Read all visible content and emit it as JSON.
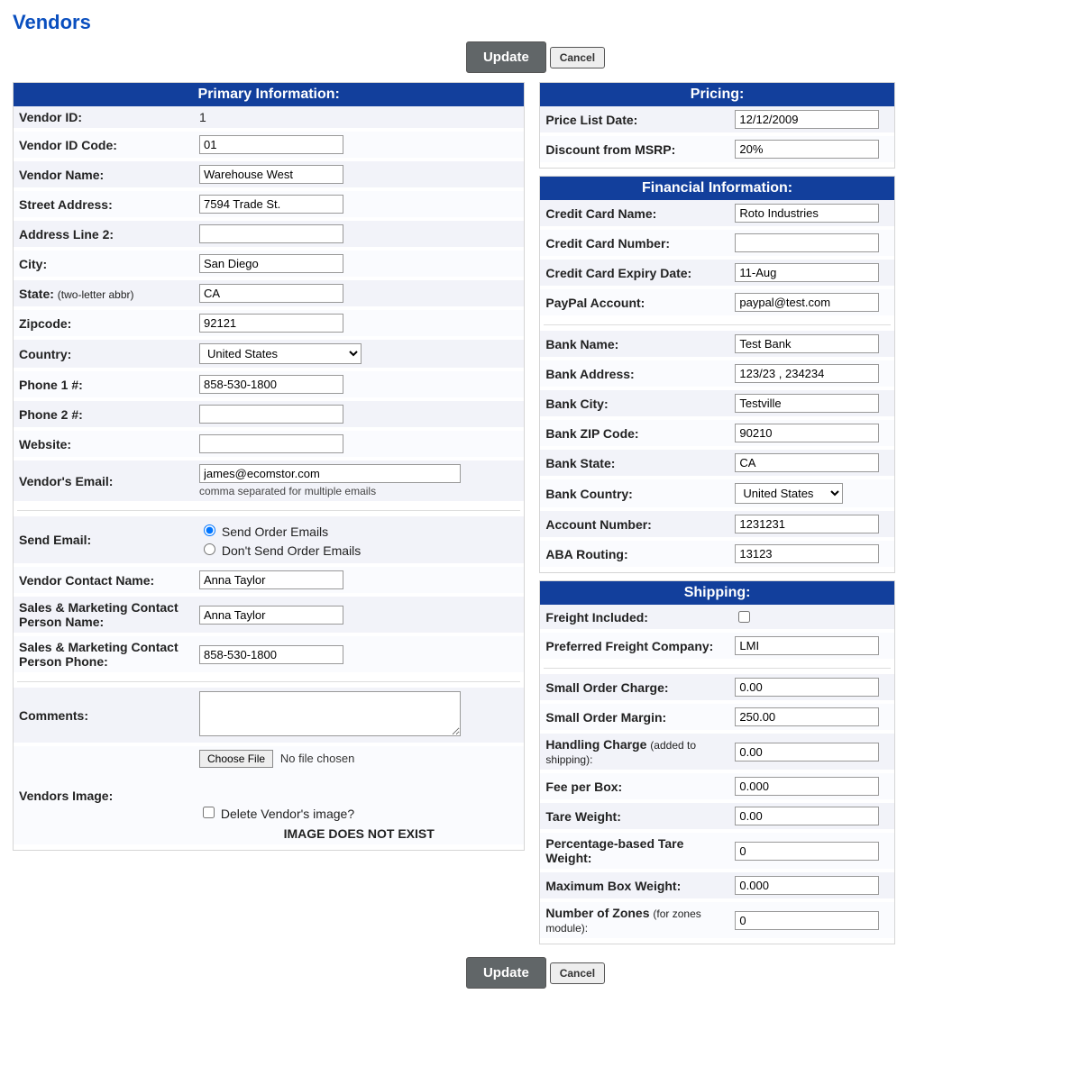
{
  "title": "Vendors",
  "buttons": {
    "update": "Update",
    "cancel": "Cancel"
  },
  "primary": {
    "header": "Primary Information:",
    "labels": {
      "vendor_id": "Vendor ID:",
      "vendor_id_code": "Vendor ID Code:",
      "vendor_name": "Vendor Name:",
      "street": "Street Address:",
      "addr2": "Address Line 2:",
      "city": "City:",
      "state": "State:",
      "state_sub": "(two-letter abbr)",
      "zip": "Zipcode:",
      "country": "Country:",
      "phone1": "Phone 1 #:",
      "phone2": "Phone 2 #:",
      "website": "Website:",
      "email": "Vendor's Email:",
      "email_hint": "comma separated for multiple emails",
      "send_email": "Send Email:",
      "send_opt1": "Send Order Emails",
      "send_opt2": "Don't Send Order Emails",
      "contact_name": "Vendor Contact Name:",
      "sm_name": "Sales & Marketing Contact Person Name:",
      "sm_phone": "Sales & Marketing Contact Person Phone:",
      "comments": "Comments:",
      "image": "Vendors Image:",
      "choose_file": "Choose File",
      "no_file": "No file chosen",
      "delete_img": "Delete Vendor's image?",
      "img_missing": "IMAGE DOES NOT EXIST"
    },
    "values": {
      "vendor_id": "1",
      "vendor_id_code": "01",
      "vendor_name": "Warehouse West",
      "street": "7594 Trade St.",
      "addr2": "",
      "city": "San Diego",
      "state": "CA",
      "zip": "92121",
      "country": "United States",
      "phone1": "858-530-1800",
      "phone2": "",
      "website": "",
      "email": "james@ecomstor.com",
      "contact_name": "Anna Taylor",
      "sm_name": "Anna Taylor",
      "sm_phone": "858-530-1800",
      "comments": ""
    }
  },
  "pricing": {
    "header": "Pricing:",
    "labels": {
      "date": "Price List Date:",
      "discount": "Discount from MSRP:"
    },
    "values": {
      "date": "12/12/2009",
      "discount": "20%"
    }
  },
  "financial": {
    "header": "Financial Information:",
    "labels": {
      "cc_name": "Credit Card Name:",
      "cc_num": "Credit Card Number:",
      "cc_exp": "Credit Card Expiry Date:",
      "paypal": "PayPal Account:",
      "bank_name": "Bank Name:",
      "bank_addr": "Bank Address:",
      "bank_city": "Bank City:",
      "bank_zip": "Bank ZIP Code:",
      "bank_state": "Bank State:",
      "bank_country": "Bank Country:",
      "acct_num": "Account Number:",
      "aba": "ABA Routing:"
    },
    "values": {
      "cc_name": "Roto Industries",
      "cc_num": "",
      "cc_exp": "11-Aug",
      "paypal": "paypal@test.com",
      "bank_name": "Test Bank",
      "bank_addr": "123/23 , 234234",
      "bank_city": "Testville",
      "bank_zip": "90210",
      "bank_state": "CA",
      "bank_country": "United States",
      "acct_num": "1231231",
      "aba": "13123"
    }
  },
  "shipping": {
    "header": "Shipping:",
    "labels": {
      "freight_inc": "Freight Included:",
      "pref_company": "Preferred Freight Company:",
      "small_charge": "Small Order Charge:",
      "small_margin": "Small Order Margin:",
      "handling": "Handling Charge",
      "handling_sub": "(added to shipping):",
      "fee_box": "Fee per Box:",
      "tare": "Tare Weight:",
      "pct_tare": "Percentage-based Tare Weight:",
      "max_box": "Maximum Box Weight:",
      "zones": "Number of Zones",
      "zones_sub": "(for zones module):"
    },
    "values": {
      "pref_company": "LMI",
      "small_charge": "0.00",
      "small_margin": "250.00",
      "handling": "0.00",
      "fee_box": "0.000",
      "tare": "0.00",
      "pct_tare": "0",
      "max_box": "0.000",
      "zones": "0"
    }
  }
}
